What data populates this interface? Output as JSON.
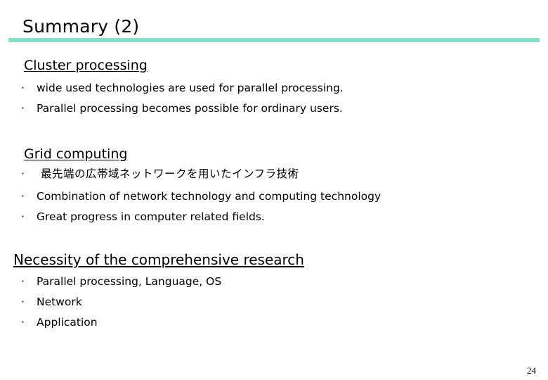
{
  "slide": {
    "title": "Summary (2)",
    "accent_color": "#85e0c7",
    "page_number": "24"
  },
  "sections": [
    {
      "heading": "Cluster processing",
      "bullets": [
        "wide used technologies are used for parallel processing.",
        "Parallel processing becomes possible for ordinary users."
      ]
    },
    {
      "heading": "Grid computing",
      "bullets": [
        "最先端の広帯域ネットワークを用いたインフラ技術",
        "Combination of network technology and computing technology",
        "Great progress in computer related fields."
      ]
    },
    {
      "heading": "Necessity of the comprehensive research",
      "bullets": [
        "Parallel processing, Language, OS",
        "Network",
        "Application"
      ]
    }
  ],
  "bullet_glyph": "·"
}
